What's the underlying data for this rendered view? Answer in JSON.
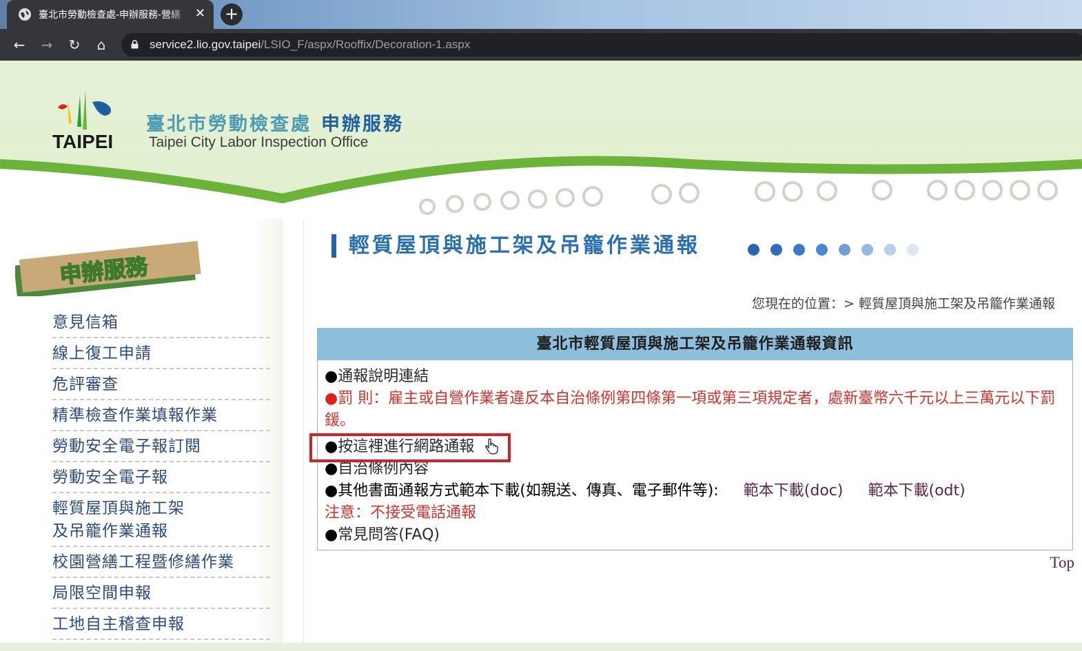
{
  "browser": {
    "tab_title": "臺北市勞動檢查處-申辦服務-營繕",
    "tab_close": "✕",
    "new_tab": "+",
    "url_host": "service2.lio.gov.taipei",
    "url_path": "/LSIO_F/aspx/Rooffix/Decoration-1.aspx",
    "nav_icons": [
      "back-arrow-icon",
      "forward-arrow-icon",
      "reload-icon",
      "home-icon",
      "lock-icon"
    ],
    "back": "←",
    "forward": "→",
    "reload": "↻",
    "home": "⌂"
  },
  "header": {
    "logo_text": "TAIPEI",
    "title_zh": "臺北市勞動檢查處",
    "title_service": "申辦服務",
    "title_en": "Taipei City Labor Inspection Office"
  },
  "sidebar": {
    "badge": "申辦服務",
    "items": [
      {
        "label": "意見信箱"
      },
      {
        "label": "線上復工申請"
      },
      {
        "label": "危評審查"
      },
      {
        "label": "精準檢查作業填報作業"
      },
      {
        "label": "勞動安全電子報訂閱"
      },
      {
        "label": "勞動安全電子報"
      },
      {
        "label": "輕質屋頂與施工架",
        "label2": "及吊籠作業通報"
      },
      {
        "label": "校園營繕工程暨修繕作業"
      },
      {
        "label": "局限空間申報"
      },
      {
        "label": "工地自主稽查申報"
      }
    ]
  },
  "main": {
    "page_title": "輕質屋頂與施工架及吊籠作業通報",
    "dot_colors": [
      "#2a62b4",
      "#2f6cc0",
      "#3b78c8",
      "#4b87d0",
      "#6c9fd8",
      "#93b8e2",
      "#b9d0ec",
      "#dbe7f5"
    ],
    "breadcrumb": "您現在的位置：> 輕質屋頂與施工架及吊籠作業通報",
    "info_header": "臺北市輕質屋頂與施工架及吊籠作業通報資訊",
    "bullet": "●",
    "link_explain": "通報說明連結",
    "penalty": "罰 則：雇主或自營作業者違反本自治條例第四條第一項或第三項規定者，處新臺幣六千元以上三萬元以下罰鍰。",
    "link_online": "按這裡進行網路通報",
    "link_ordinance": "自治條例內容",
    "other_methods": "其他書面通報方式範本下載(如親送、傳真、電子郵件等):",
    "download_doc": "範本下載(doc)",
    "download_odt": "範本下載(odt)",
    "notice": "注意：不接受電話通報",
    "link_faq": "常見問答(FAQ)",
    "top": "Top"
  }
}
